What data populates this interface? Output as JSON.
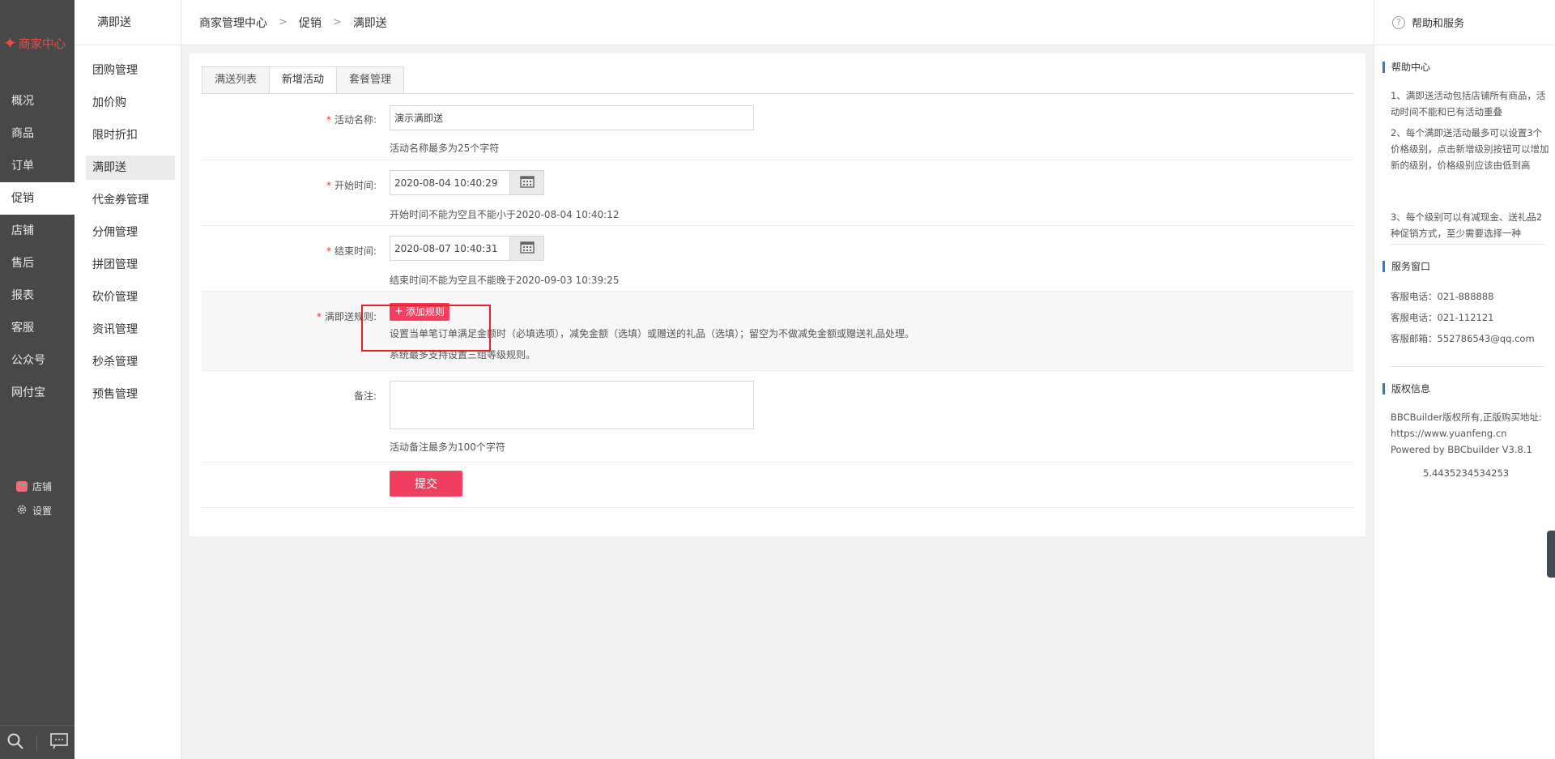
{
  "sidebar": {
    "logo_text": "商家中心",
    "nav": [
      "概况",
      "商品",
      "订单",
      "促销",
      "店铺",
      "售后",
      "报表",
      "客服",
      "公众号",
      "网付宝"
    ],
    "active_index": 3,
    "shop_label": "店铺",
    "settings_label": "设置",
    "bottom_icons": [
      "search-icon",
      "chat-icon"
    ]
  },
  "subnav": {
    "title": "满即送",
    "items": [
      "团购管理",
      "加价购",
      "限时折扣",
      "满即送",
      "代金券管理",
      "分佣管理",
      "拼团管理",
      "砍价管理",
      "资讯管理",
      "秒杀管理",
      "预售管理"
    ],
    "active_index": 3
  },
  "breadcrumb": [
    "商家管理中心",
    "促销",
    "满即送"
  ],
  "tabs": [
    "满送列表",
    "新增活动",
    "套餐管理"
  ],
  "active_tab": 1,
  "form": {
    "name": {
      "label": "活动名称:",
      "value": "演示满即送",
      "hint": "活动名称最多为25个字符"
    },
    "start": {
      "label": "开始时间:",
      "value": "2020-08-04 10:40:29",
      "hint": "开始时间不能为空且不能小于2020-08-04 10:40:12"
    },
    "end": {
      "label": "结束时间:",
      "value": "2020-08-07 10:40:31",
      "hint": "结束时间不能为空且不能晚于2020-09-03 10:39:25"
    },
    "rule": {
      "label": "满即送规则:",
      "button": "添加规则",
      "hint1": "设置当单笔订单满足金额时（必填选项），减免金额（选填）或赠送的礼品（选填）；留空为不做减免金额或赠送礼品处理。",
      "hint2": "系统最多支持设置三组等级规则。"
    },
    "remark": {
      "label": "备注:",
      "hint": "活动备注最多为100个字符"
    },
    "submit": "提交"
  },
  "help": {
    "header": "帮助和服务",
    "center_title": "帮助中心",
    "center_items": [
      "1、满即送活动包括店铺所有商品，活动时间不能和已有活动重叠",
      "2、每个满即送活动最多可以设置3个价格级别，点击新增级别按钮可以增加新的级别，价格级别应该由低到高",
      "3、每个级别可以有减现金、送礼品2种促销方式，至少需要选择一种"
    ],
    "service_title": "服务窗口",
    "service_items": [
      "客服电话：021-888888",
      "客服电话：021-112121",
      "客服邮箱：552786543@qq.com"
    ],
    "copyright_title": "版权信息",
    "copyright_lines": [
      "BBCBuilder版权所有,正版购买地址:",
      "https://www.yuanfeng.cn",
      "Powered by BBCbuilder V3.8.1"
    ],
    "version_number": "5.4435234534253"
  },
  "colors": {
    "accent": "#f23f5f",
    "highlight": "#e8202a",
    "sidebar_bg": "#484848",
    "help_bar": "#2b7cd3"
  }
}
